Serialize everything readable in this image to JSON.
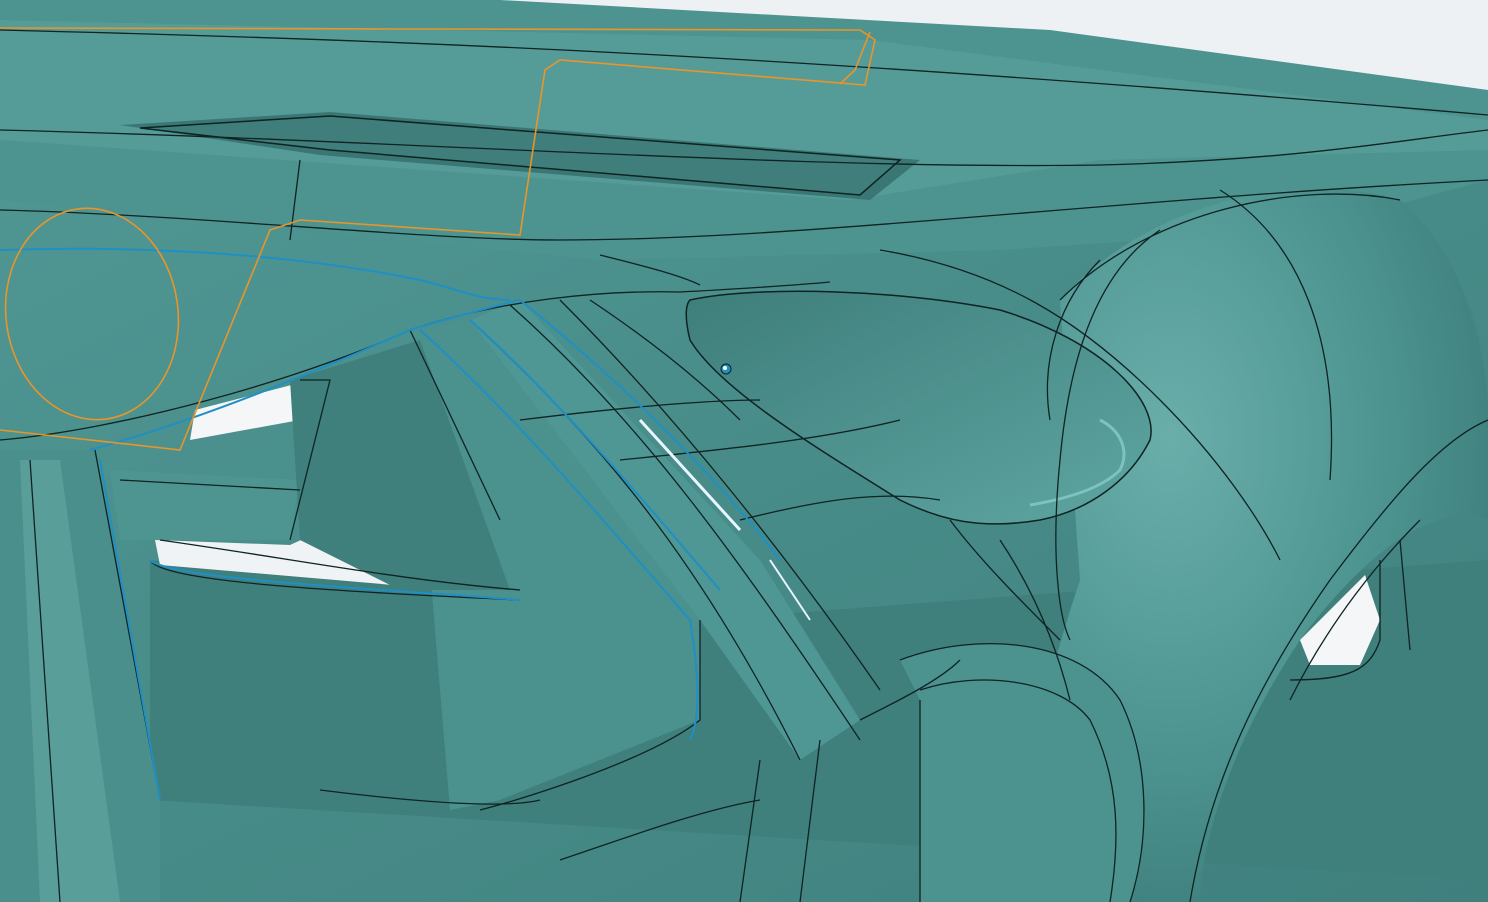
{
  "app": {
    "type": "3D CAD graphics viewport"
  },
  "viewport": {
    "background_color": "#eef1f3",
    "floor_color": "#8f9496"
  },
  "model": {
    "surface_color": "#4d9390",
    "surface_light_color": "#5fa6a2",
    "surface_dark_color": "#3d7c79",
    "edge_color": "#0f2322",
    "selected_edge_color": "#1f8fc4",
    "sketch_color": "#e8952a",
    "glass_gap_color": "#f4f6f8"
  },
  "icons": {
    "origin_marker": "point-marker-icon"
  }
}
